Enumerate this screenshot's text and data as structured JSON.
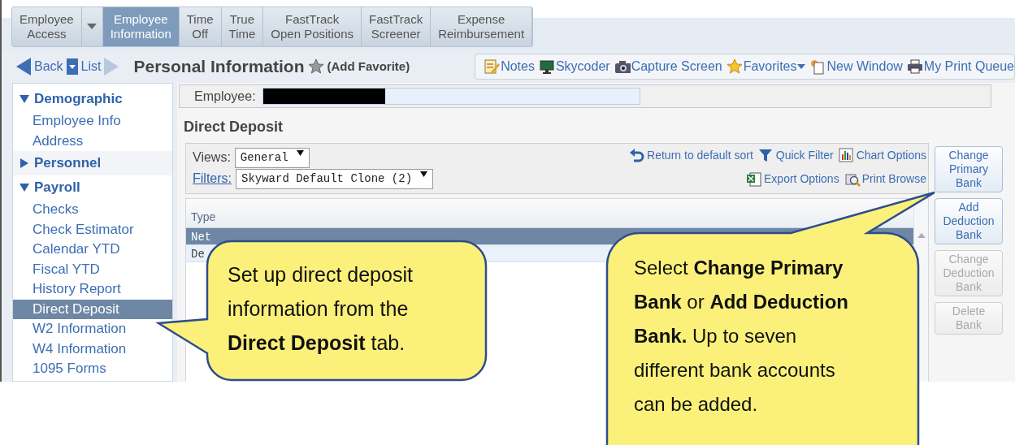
{
  "top_tabs": [
    {
      "label": "Employee\nAccess",
      "selected": false,
      "dropdown": true
    },
    {
      "label": "Employee\nInformation",
      "selected": true,
      "dropdown": false
    },
    {
      "label": "Time\nOff",
      "selected": false,
      "dropdown": false
    },
    {
      "label": "True\nTime",
      "selected": false,
      "dropdown": false
    },
    {
      "label": "FastTrack\nOpen Positions",
      "selected": false,
      "dropdown": false
    },
    {
      "label": "FastTrack\nScreener",
      "selected": false,
      "dropdown": false
    },
    {
      "label": "Expense\nReimbursement",
      "selected": false,
      "dropdown": false
    }
  ],
  "nav": {
    "back": "Back",
    "list": "List",
    "title": "Personal Information",
    "favorite": "(Add Favorite)"
  },
  "toolbar": [
    {
      "kind": "notes",
      "label": "Notes"
    },
    {
      "kind": "monitor",
      "label": "Skycoder"
    },
    {
      "kind": "camera",
      "label": "Capture Screen"
    },
    {
      "kind": "star",
      "label": "Favorites",
      "dropdown": true
    },
    {
      "kind": "window",
      "label": "New Window"
    },
    {
      "kind": "printer",
      "label": "My Print Queue"
    }
  ],
  "sidebar": [
    {
      "label": "Demographic",
      "expanded": true,
      "items": [
        {
          "label": "Employee Info",
          "selected": false
        },
        {
          "label": "Address",
          "selected": false
        }
      ]
    },
    {
      "label": "Personnel",
      "expanded": false
    },
    {
      "label": "Payroll",
      "expanded": true,
      "items": [
        {
          "label": "Checks",
          "selected": false
        },
        {
          "label": "Check Estimator",
          "selected": false
        },
        {
          "label": "Calendar YTD",
          "selected": false
        },
        {
          "label": "Fiscal YTD",
          "selected": false
        },
        {
          "label": "History Report",
          "selected": false
        },
        {
          "label": "Direct Deposit",
          "selected": true
        },
        {
          "label": "W2 Information",
          "selected": false
        },
        {
          "label": "W4 Information",
          "selected": false
        },
        {
          "label": "1095 Forms",
          "selected": false
        }
      ]
    }
  ],
  "employee": {
    "label": "Employee:",
    "redacted": true
  },
  "section_title": "Direct Deposit",
  "views": {
    "label": "Views:",
    "value": "General"
  },
  "filters": {
    "label": "Filters:",
    "value": "Skyward Default Clone (2)"
  },
  "grid_tools": [
    [
      {
        "kind": "undo",
        "label": "Return to default sort"
      },
      {
        "kind": "funnel",
        "label": "Quick Filter"
      },
      {
        "kind": "chart",
        "label": "Chart Options"
      }
    ],
    [
      {
        "kind": "sheet",
        "label": "Export Options"
      },
      {
        "kind": "magnifier",
        "label": "Print Browse"
      }
    ]
  ],
  "table": {
    "columns": [
      "Type"
    ],
    "rows": [
      {
        "cells": [
          "Net"
        ],
        "selected": true
      },
      {
        "cells": [
          "De"
        ],
        "selected": false
      }
    ]
  },
  "side_buttons": [
    {
      "label": "Change Primary Bank",
      "disabled": false
    },
    {
      "label": "Add Deduction Bank",
      "disabled": false
    },
    {
      "label": "Change Deduction Bank",
      "disabled": true
    },
    {
      "label": "Delete Bank",
      "disabled": true
    }
  ],
  "callouts": [
    {
      "kind": "left",
      "text": "Set up direct deposit information from the **Direct Deposit** tab."
    },
    {
      "kind": "right",
      "text": "Select **Change Primary Bank** or **Add Deduction Bank.**  Up to seven different bank accounts can be added."
    }
  ]
}
